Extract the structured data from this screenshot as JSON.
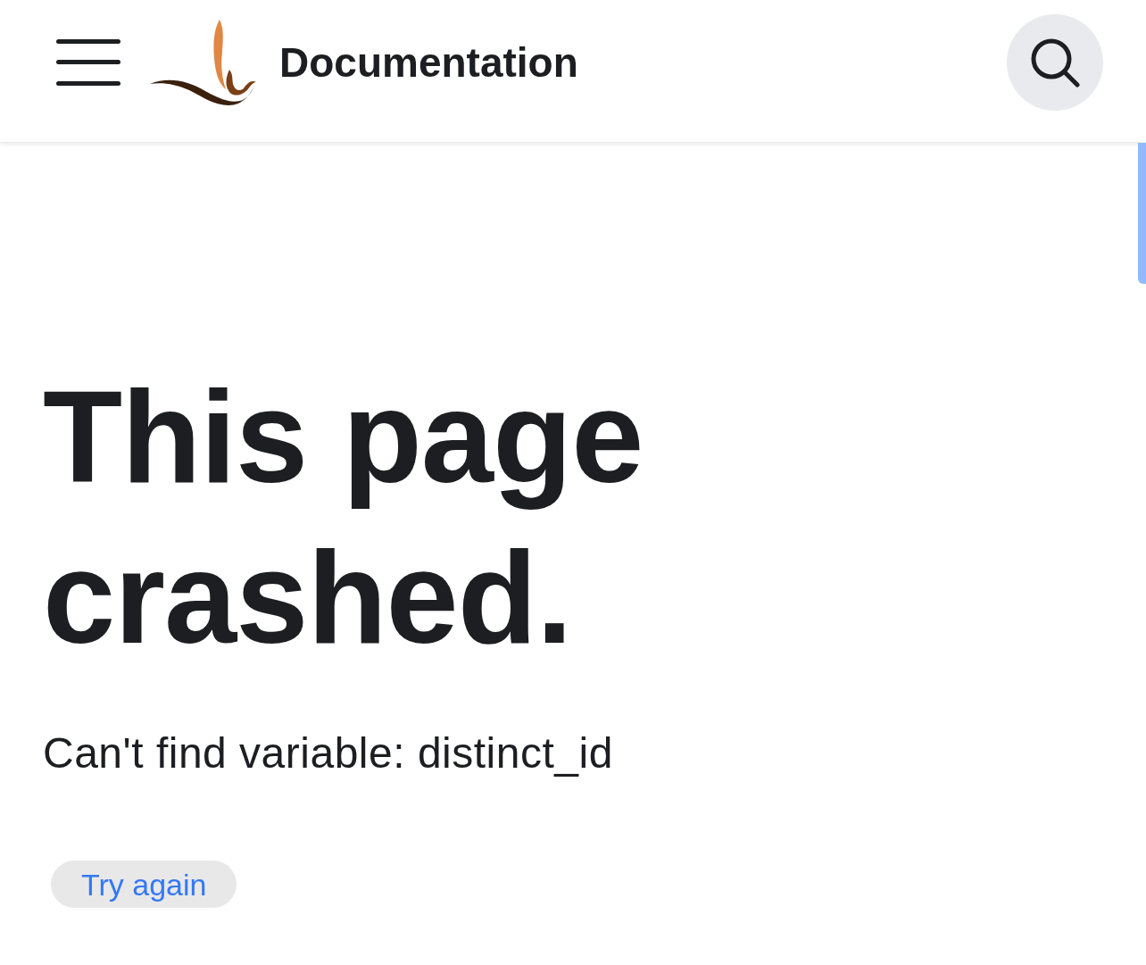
{
  "header": {
    "title": "Documentation"
  },
  "error": {
    "heading": "This page crashed.",
    "message": "Can't find variable: distinct_id"
  },
  "buttons": [
    {
      "label": "Try again"
    }
  ]
}
